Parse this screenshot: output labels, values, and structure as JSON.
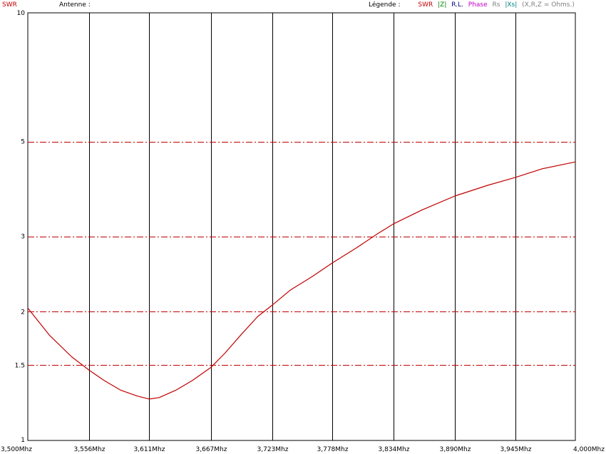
{
  "header": {
    "swr_label": "SWR",
    "antenne_label": "Antenne :",
    "legend_title": "Légende :",
    "legend_items": [
      {
        "label": "SWR",
        "color": "#c00000"
      },
      {
        "label": "|Z|",
        "color": "#008000"
      },
      {
        "label": "R.L.",
        "color": "#000080"
      },
      {
        "label": "Phase",
        "color": "#c000c0"
      },
      {
        "label": "Rs",
        "color": "#808080"
      },
      {
        "label": "|Xs|",
        "color": "#008080"
      },
      {
        "label": "(X,R,Z = Ohms.)",
        "color": "#808080"
      }
    ]
  },
  "chart_data": {
    "type": "line",
    "ylabel": "SWR",
    "y_scale": "log",
    "ylim": [
      1,
      10
    ],
    "y_ticks": [
      {
        "value": 10,
        "label": "10"
      },
      {
        "value": 5,
        "label": "5"
      },
      {
        "value": 3,
        "label": "3"
      },
      {
        "value": 2,
        "label": "2"
      },
      {
        "value": 1.5,
        "label": "1.5"
      },
      {
        "value": 1,
        "label": "1"
      }
    ],
    "xlim": [
      3.5,
      4.0
    ],
    "x_ticks": [
      {
        "value": 3.5,
        "label": "3,500Mhz"
      },
      {
        "value": 3.556,
        "label": "3,556Mhz"
      },
      {
        "value": 3.611,
        "label": "3,611Mhz"
      },
      {
        "value": 3.667,
        "label": "3,667Mhz"
      },
      {
        "value": 3.723,
        "label": "3,723Mhz"
      },
      {
        "value": 3.778,
        "label": "3,778Mhz"
      },
      {
        "value": 3.834,
        "label": "3,834Mhz"
      },
      {
        "value": 3.89,
        "label": "3,890Mhz"
      },
      {
        "value": 3.945,
        "label": "3,945Mhz"
      },
      {
        "value": 4.0,
        "label": "4,000Mhz"
      }
    ],
    "dashed_grid_y": [
      5,
      3,
      2,
      1.5
    ],
    "series": [
      {
        "name": "SWR",
        "color": "#c00000",
        "x": [
          3.5,
          3.52,
          3.54,
          3.556,
          3.57,
          3.585,
          3.6,
          3.611,
          3.62,
          3.635,
          3.65,
          3.667,
          3.68,
          3.695,
          3.71,
          3.723,
          3.74,
          3.76,
          3.778,
          3.8,
          3.82,
          3.834,
          3.86,
          3.89,
          3.92,
          3.945,
          3.97,
          4.0
        ],
        "y": [
          2.04,
          1.76,
          1.57,
          1.46,
          1.38,
          1.31,
          1.27,
          1.25,
          1.26,
          1.31,
          1.38,
          1.48,
          1.6,
          1.77,
          1.95,
          2.07,
          2.25,
          2.42,
          2.6,
          2.82,
          3.05,
          3.21,
          3.46,
          3.73,
          3.95,
          4.12,
          4.32,
          4.48
        ]
      }
    ]
  }
}
